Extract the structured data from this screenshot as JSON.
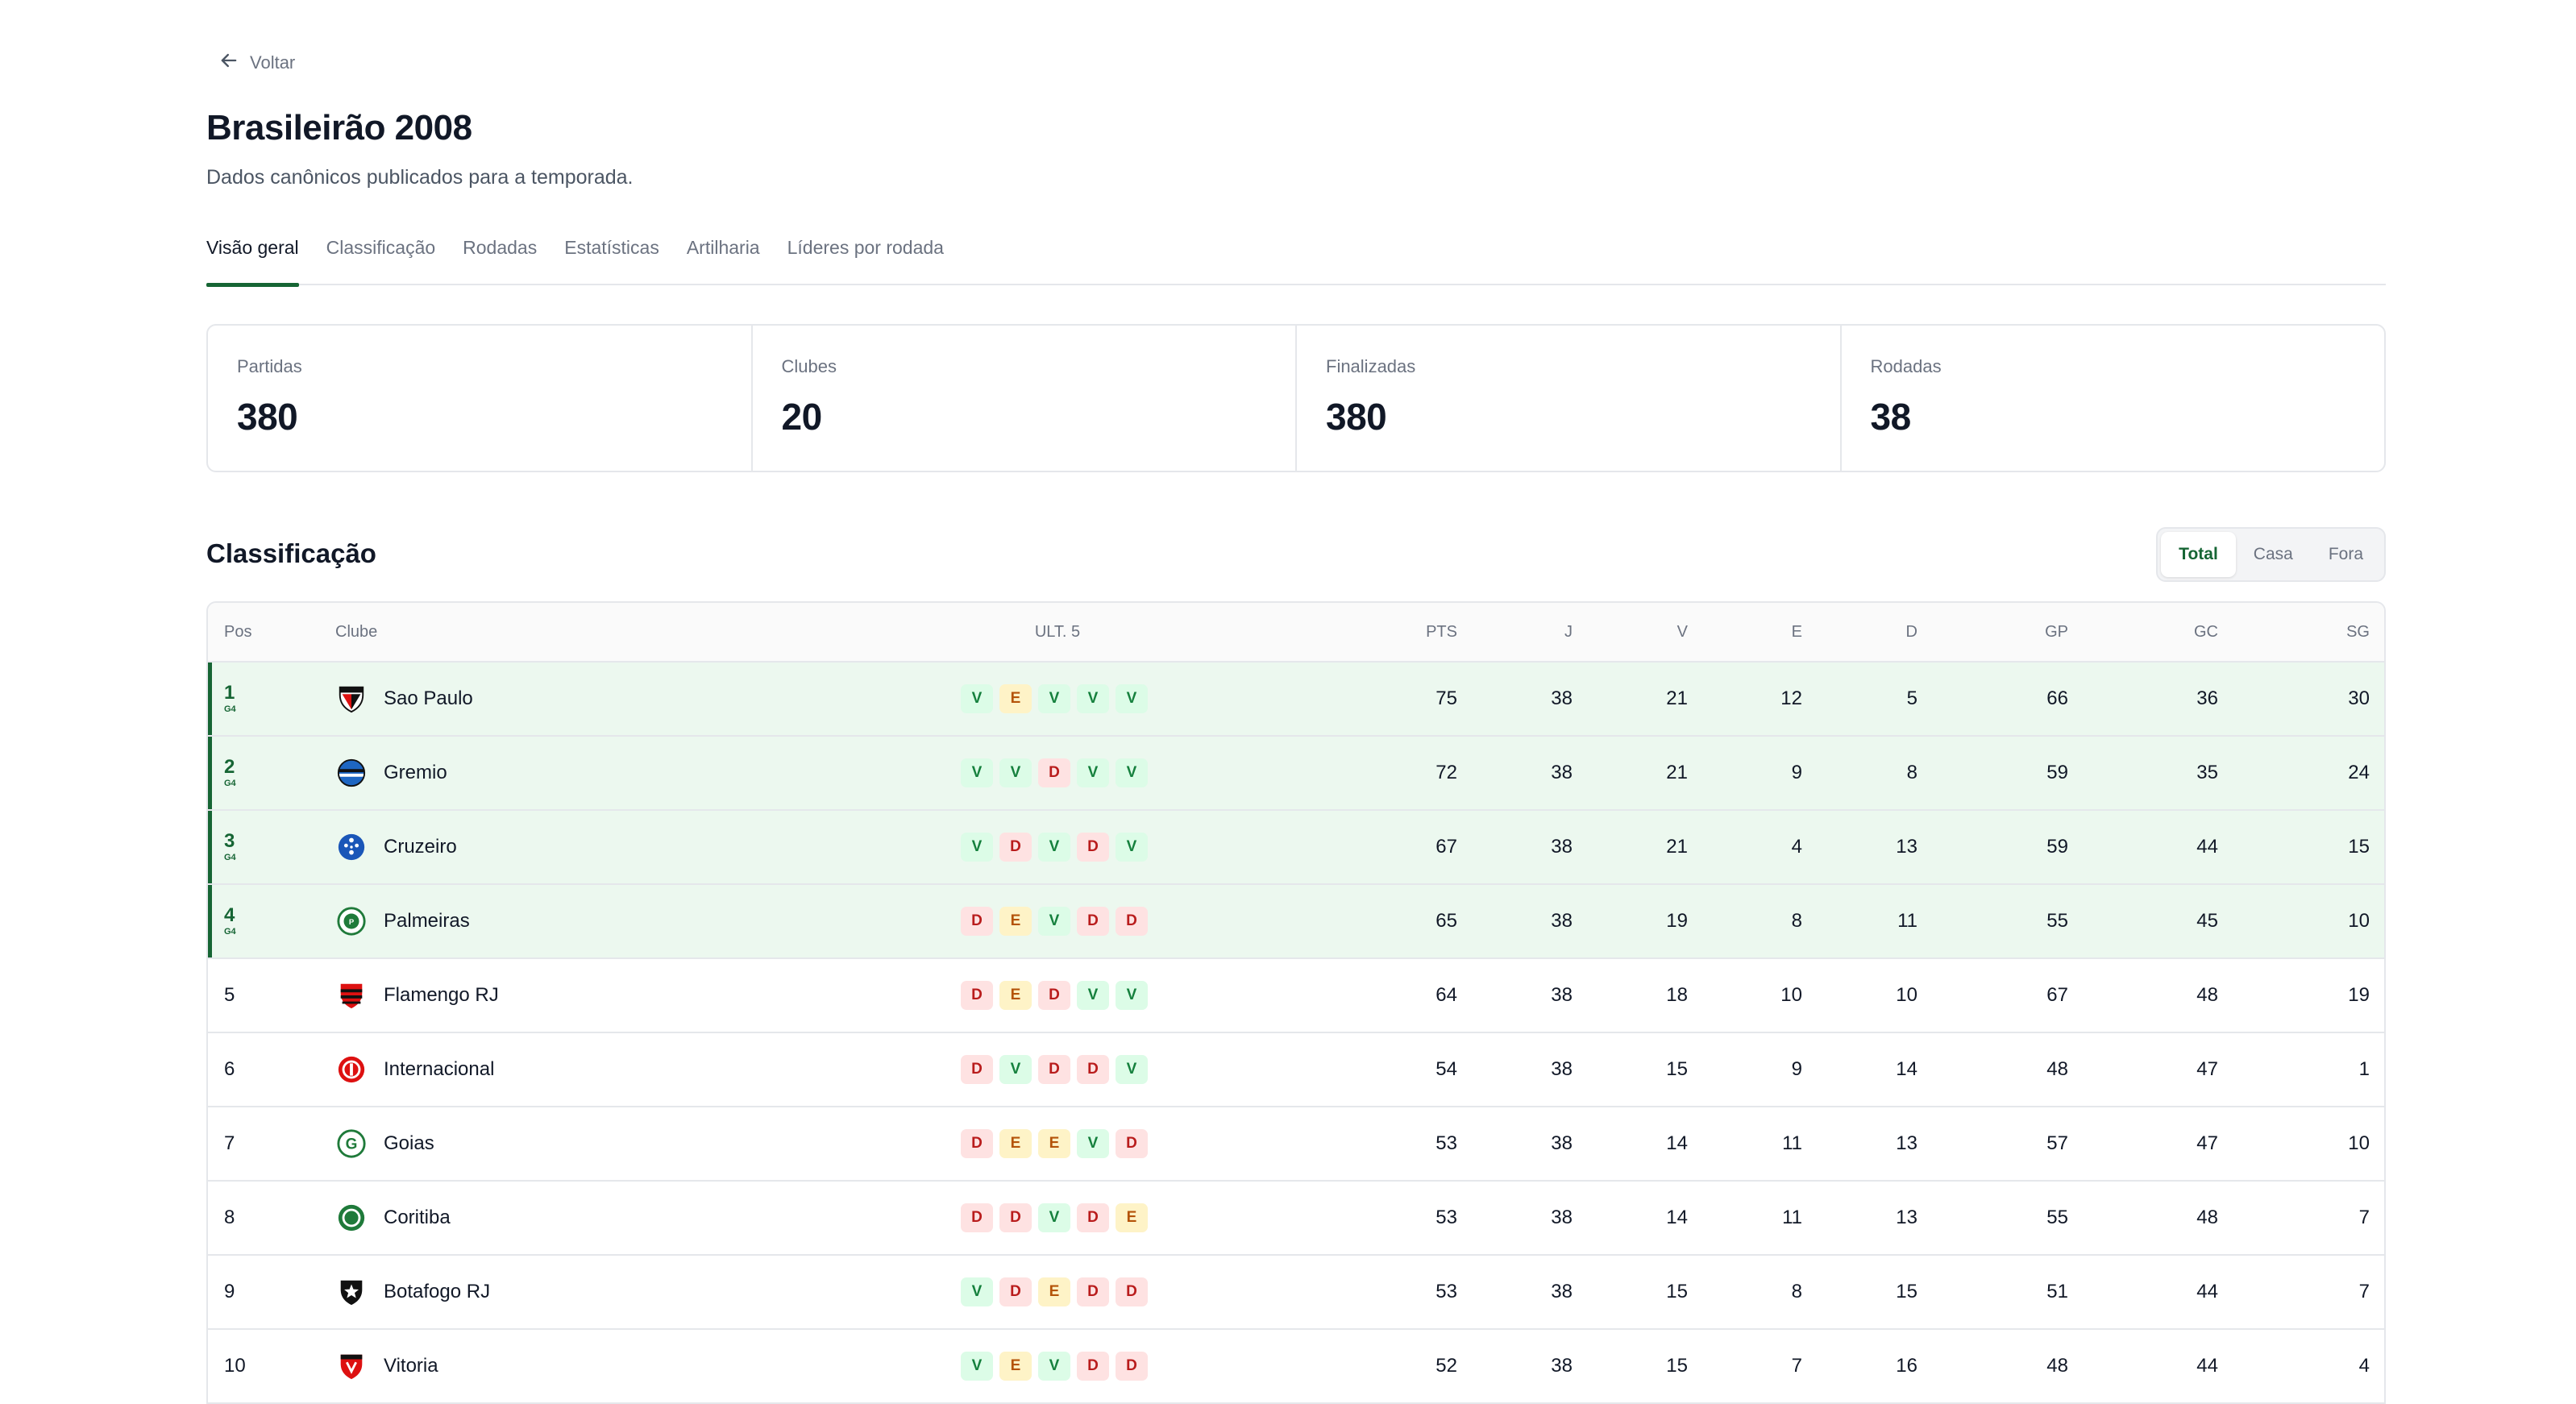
{
  "nav": {
    "back_label": "Voltar"
  },
  "header": {
    "title": "Brasileirão 2008",
    "subtitle": "Dados canônicos publicados para a temporada."
  },
  "tabs": [
    {
      "label": "Visão geral",
      "active": true
    },
    {
      "label": "Classificação",
      "active": false
    },
    {
      "label": "Rodadas",
      "active": false
    },
    {
      "label": "Estatísticas",
      "active": false
    },
    {
      "label": "Artilharia",
      "active": false
    },
    {
      "label": "Líderes por rodada",
      "active": false
    }
  ],
  "stats": [
    {
      "label": "Partidas",
      "value": "380"
    },
    {
      "label": "Clubes",
      "value": "20"
    },
    {
      "label": "Finalizadas",
      "value": "380"
    },
    {
      "label": "Rodadas",
      "value": "38"
    }
  ],
  "standings": {
    "title": "Classificação",
    "filters": [
      {
        "label": "Total",
        "active": true
      },
      {
        "label": "Casa",
        "active": false
      },
      {
        "label": "Fora",
        "active": false
      }
    ],
    "columns": {
      "pos": "Pos",
      "club": "Clube",
      "form": "ULT. 5",
      "pts": "PTS",
      "j": "J",
      "v": "V",
      "e": "E",
      "d": "D",
      "gp": "GP",
      "gc": "GC",
      "sg": "SG"
    },
    "rows": [
      {
        "pos": "1",
        "badge": "G4",
        "club": "Sao Paulo",
        "crest": "sao-paulo-crest-icon",
        "form": [
          "V",
          "E",
          "V",
          "V",
          "V"
        ],
        "pts": "75",
        "j": "38",
        "v": "21",
        "e": "12",
        "d": "5",
        "gp": "66",
        "gc": "36",
        "sg": "30"
      },
      {
        "pos": "2",
        "badge": "G4",
        "club": "Gremio",
        "crest": "gremio-crest-icon",
        "form": [
          "V",
          "V",
          "D",
          "V",
          "V"
        ],
        "pts": "72",
        "j": "38",
        "v": "21",
        "e": "9",
        "d": "8",
        "gp": "59",
        "gc": "35",
        "sg": "24"
      },
      {
        "pos": "3",
        "badge": "G4",
        "club": "Cruzeiro",
        "crest": "cruzeiro-crest-icon",
        "form": [
          "V",
          "D",
          "V",
          "D",
          "V"
        ],
        "pts": "67",
        "j": "38",
        "v": "21",
        "e": "4",
        "d": "13",
        "gp": "59",
        "gc": "44",
        "sg": "15"
      },
      {
        "pos": "4",
        "badge": "G4",
        "club": "Palmeiras",
        "crest": "palmeiras-crest-icon",
        "form": [
          "D",
          "E",
          "V",
          "D",
          "D"
        ],
        "pts": "65",
        "j": "38",
        "v": "19",
        "e": "8",
        "d": "11",
        "gp": "55",
        "gc": "45",
        "sg": "10"
      },
      {
        "pos": "5",
        "badge": "",
        "club": "Flamengo RJ",
        "crest": "flamengo-crest-icon",
        "form": [
          "D",
          "E",
          "D",
          "V",
          "V"
        ],
        "pts": "64",
        "j": "38",
        "v": "18",
        "e": "10",
        "d": "10",
        "gp": "67",
        "gc": "48",
        "sg": "19"
      },
      {
        "pos": "6",
        "badge": "",
        "club": "Internacional",
        "crest": "internacional-crest-icon",
        "form": [
          "D",
          "V",
          "D",
          "D",
          "V"
        ],
        "pts": "54",
        "j": "38",
        "v": "15",
        "e": "9",
        "d": "14",
        "gp": "48",
        "gc": "47",
        "sg": "1"
      },
      {
        "pos": "7",
        "badge": "",
        "club": "Goias",
        "crest": "goias-crest-icon",
        "form": [
          "D",
          "E",
          "E",
          "V",
          "D"
        ],
        "pts": "53",
        "j": "38",
        "v": "14",
        "e": "11",
        "d": "13",
        "gp": "57",
        "gc": "47",
        "sg": "10"
      },
      {
        "pos": "8",
        "badge": "",
        "club": "Coritiba",
        "crest": "coritiba-crest-icon",
        "form": [
          "D",
          "D",
          "V",
          "D",
          "E"
        ],
        "pts": "53",
        "j": "38",
        "v": "14",
        "e": "11",
        "d": "13",
        "gp": "55",
        "gc": "48",
        "sg": "7"
      },
      {
        "pos": "9",
        "badge": "",
        "club": "Botafogo RJ",
        "crest": "botafogo-crest-icon",
        "form": [
          "V",
          "D",
          "E",
          "D",
          "D"
        ],
        "pts": "53",
        "j": "38",
        "v": "15",
        "e": "8",
        "d": "15",
        "gp": "51",
        "gc": "44",
        "sg": "7"
      },
      {
        "pos": "10",
        "badge": "",
        "club": "Vitoria",
        "crest": "vitoria-crest-icon",
        "form": [
          "V",
          "E",
          "V",
          "D",
          "D"
        ],
        "pts": "52",
        "j": "38",
        "v": "15",
        "e": "7",
        "d": "16",
        "gp": "48",
        "gc": "44",
        "sg": "4"
      }
    ]
  },
  "colors": {
    "accent": "#166534",
    "g4_row_bg": "#ecf8ef",
    "win": "#15803d",
    "draw": "#b45309",
    "loss": "#b91c1c"
  }
}
